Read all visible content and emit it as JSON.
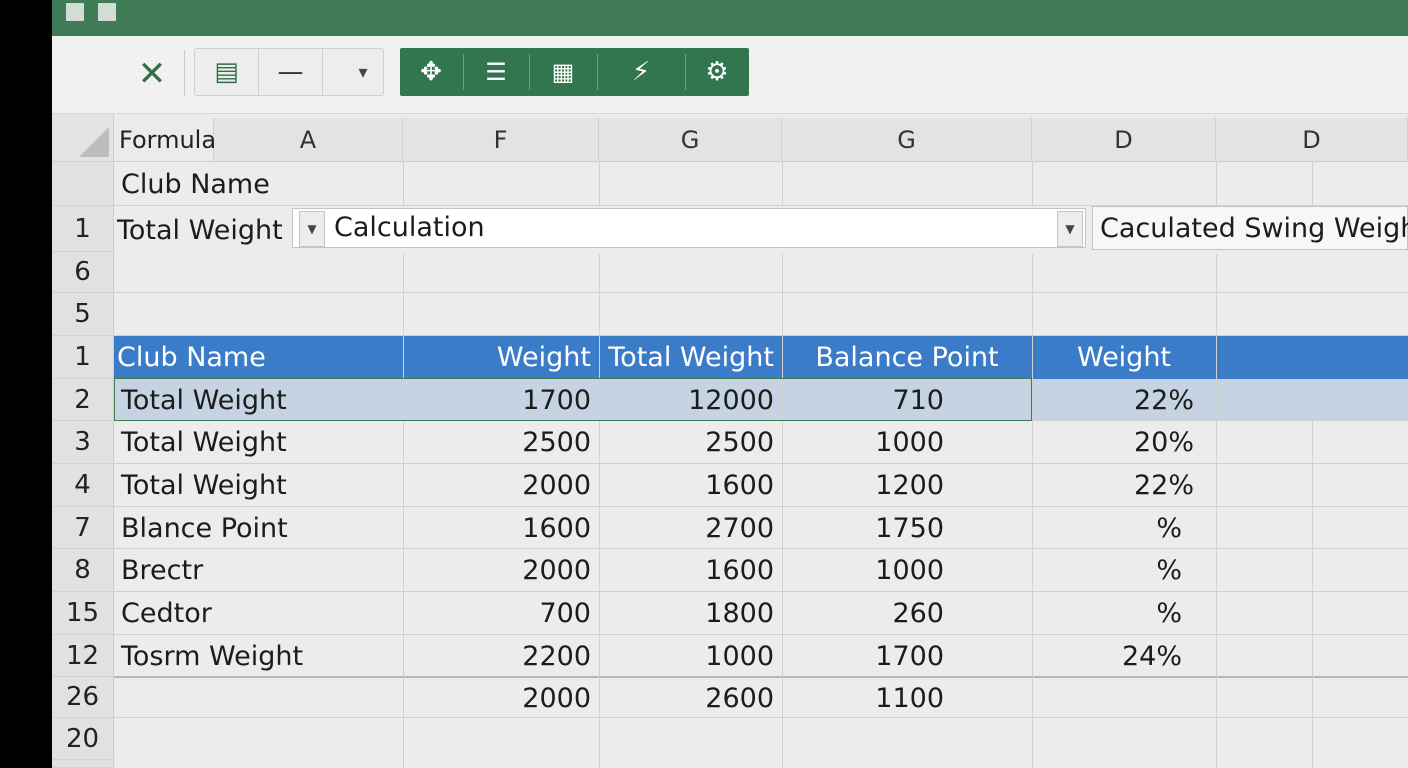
{
  "toolbar": {
    "close_glyph": "✕",
    "light_buttons": [
      {
        "name": "form-icon",
        "glyph": "▤"
      },
      {
        "name": "minus-icon",
        "glyph": "—"
      },
      {
        "name": "dropdown-arrow-icon",
        "glyph": "▾"
      }
    ],
    "green_buttons": [
      {
        "name": "move-icon",
        "glyph": "✥"
      },
      {
        "name": "document-icon",
        "glyph": "☰"
      },
      {
        "name": "card-icon",
        "glyph": "▦"
      },
      {
        "name": "flash-icon",
        "glyph": "⚡"
      },
      {
        "name": "gear-icon",
        "glyph": "⚙"
      }
    ]
  },
  "grid": {
    "formula_label": "Formula",
    "column_headers": [
      "A",
      "F",
      "G",
      "G",
      "D",
      "D"
    ],
    "top_rows": {
      "row_club_label": "Club Name",
      "row1_number": "1",
      "row1_label": "Total Weight",
      "calc_value": "Calculation",
      "swing_value": "Caculated Swing Weight",
      "row6_number": "6",
      "row5_number": "5"
    },
    "table_header": {
      "row_number": "1",
      "cells": [
        "Club Name",
        "Weight",
        "Total Weight",
        "Balance Point",
        "Weight"
      ]
    },
    "rows": [
      {
        "num": "2",
        "cells": [
          "Total Weight",
          "1700",
          "12000",
          "710",
          "22%"
        ]
      },
      {
        "num": "3",
        "cells": [
          "Total Weight",
          "2500",
          "2500",
          "1000",
          "20%"
        ]
      },
      {
        "num": "4",
        "cells": [
          "Total Weight",
          "2000",
          "1600",
          "1200",
          "22%"
        ]
      },
      {
        "num": "7",
        "cells": [
          "Blance Point",
          "1600",
          "2700",
          "1750",
          "%"
        ]
      },
      {
        "num": "8",
        "cells": [
          "Brectr",
          "2000",
          "1600",
          "1000",
          "%"
        ]
      },
      {
        "num": "15",
        "cells": [
          "Cedtor",
          "700",
          "1800",
          "260",
          "%"
        ]
      },
      {
        "num": "12",
        "cells": [
          "Tosrm Weight",
          "2200",
          "1000",
          "1700",
          "24%"
        ]
      },
      {
        "num": "26",
        "cells": [
          "",
          "2000",
          "2600",
          "1100",
          ""
        ]
      },
      {
        "num": "20",
        "cells": [
          "",
          "",
          "",
          "",
          ""
        ]
      }
    ]
  },
  "colors": {
    "title_bar": "#3f7b57",
    "accent_green": "#327650",
    "header_blue": "#3b7cc9",
    "selection_blue": "#c5d3e2"
  }
}
